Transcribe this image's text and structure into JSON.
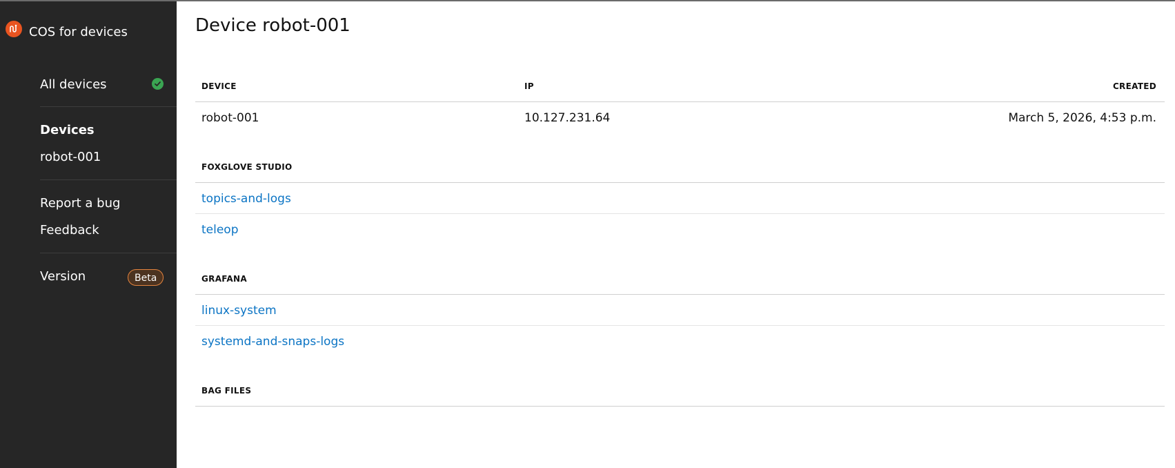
{
  "app": {
    "title": "COS for devices"
  },
  "sidebar": {
    "all_devices": "All devices",
    "devices_heading": "Devices",
    "device_item": "robot-001",
    "report_bug": "Report a bug",
    "feedback": "Feedback",
    "version_label": "Version",
    "version_badge": "Beta"
  },
  "colors": {
    "sidebar_bg": "#262626",
    "brand_accent": "#e95420",
    "status_ok": "#3aa552",
    "link": "#0b74c4",
    "badge_border": "#e5853f"
  },
  "page": {
    "title": "Device robot-001"
  },
  "device_table": {
    "headers": [
      "DEVICE",
      "IP",
      "CREATED"
    ],
    "row": [
      "robot-001",
      "10.127.231.64",
      "March 5, 2026, 4:53 p.m."
    ]
  },
  "sections": {
    "foxglove": {
      "heading": "FOXGLOVE STUDIO",
      "links": [
        "topics-and-logs",
        "teleop"
      ]
    },
    "grafana": {
      "heading": "GRAFANA",
      "links": [
        "linux-system",
        "systemd-and-snaps-logs"
      ]
    },
    "bag_files": {
      "heading": "BAG FILES"
    }
  }
}
